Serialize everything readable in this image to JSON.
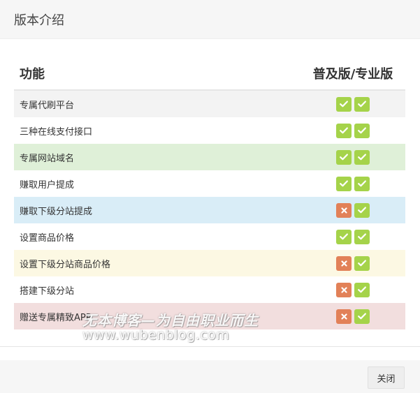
{
  "header": {
    "title": "版本介绍"
  },
  "table": {
    "col_feature": "功能",
    "col_version": "普及版/专业版",
    "rows": [
      {
        "label": "专属代刷平台",
        "basic": true,
        "pro": true,
        "bg": "#f3f3f3"
      },
      {
        "label": "三种在线支付接口",
        "basic": true,
        "pro": true,
        "bg": "#ffffff"
      },
      {
        "label": "专属网站域名",
        "basic": true,
        "pro": true,
        "bg": "#dff0d8"
      },
      {
        "label": "赚取用户提成",
        "basic": true,
        "pro": true,
        "bg": "#ffffff"
      },
      {
        "label": "赚取下级分站提成",
        "basic": false,
        "pro": true,
        "bg": "#d9edf7"
      },
      {
        "label": "设置商品价格",
        "basic": true,
        "pro": true,
        "bg": "#ffffff"
      },
      {
        "label": "设置下级分站商品价格",
        "basic": false,
        "pro": true,
        "bg": "#fcf8e3"
      },
      {
        "label": "搭建下级分站",
        "basic": false,
        "pro": true,
        "bg": "#ffffff"
      },
      {
        "label": "赠送专属精致APP",
        "basic": false,
        "pro": true,
        "bg": "#f2dede"
      }
    ]
  },
  "icons": {
    "yes": "check-icon",
    "no": "cross-icon"
  },
  "colors": {
    "yes": "#a5d34a",
    "no": "#e28158"
  },
  "watermark": {
    "line1": "无本博客—为自由职业而生",
    "line2": "www.wubenblog.com"
  },
  "footer": {
    "close_label": "关闭"
  }
}
